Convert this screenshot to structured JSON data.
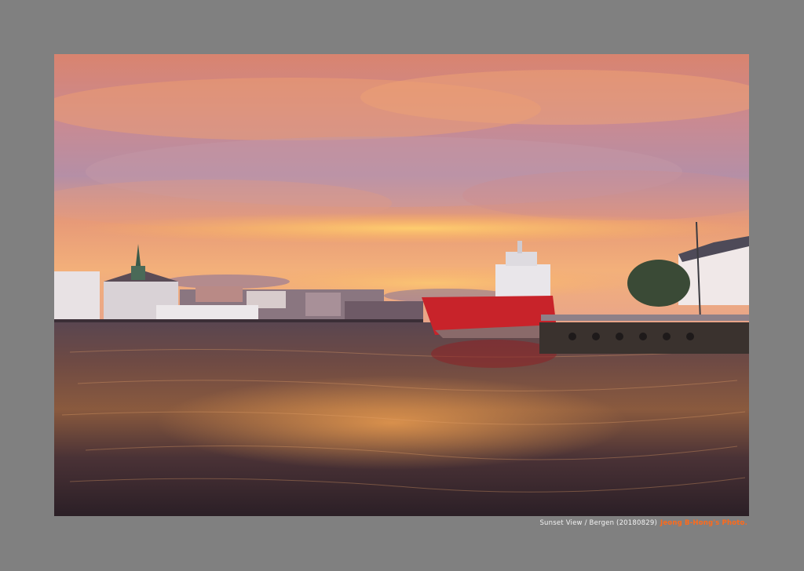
{
  "photo": {
    "subject": "harbor-sunset-photo"
  },
  "caption": {
    "description": "Sunset View / Bergen (20180829)",
    "credit": "Jeong B-Hong's Photo."
  },
  "colors": {
    "background": "#808080",
    "sky_top": "#d8826e",
    "sky_glow": "#ffb45a",
    "water": "#3a2a30",
    "ship_hull": "#c8232a",
    "credit_text": "#ff6a1a"
  }
}
